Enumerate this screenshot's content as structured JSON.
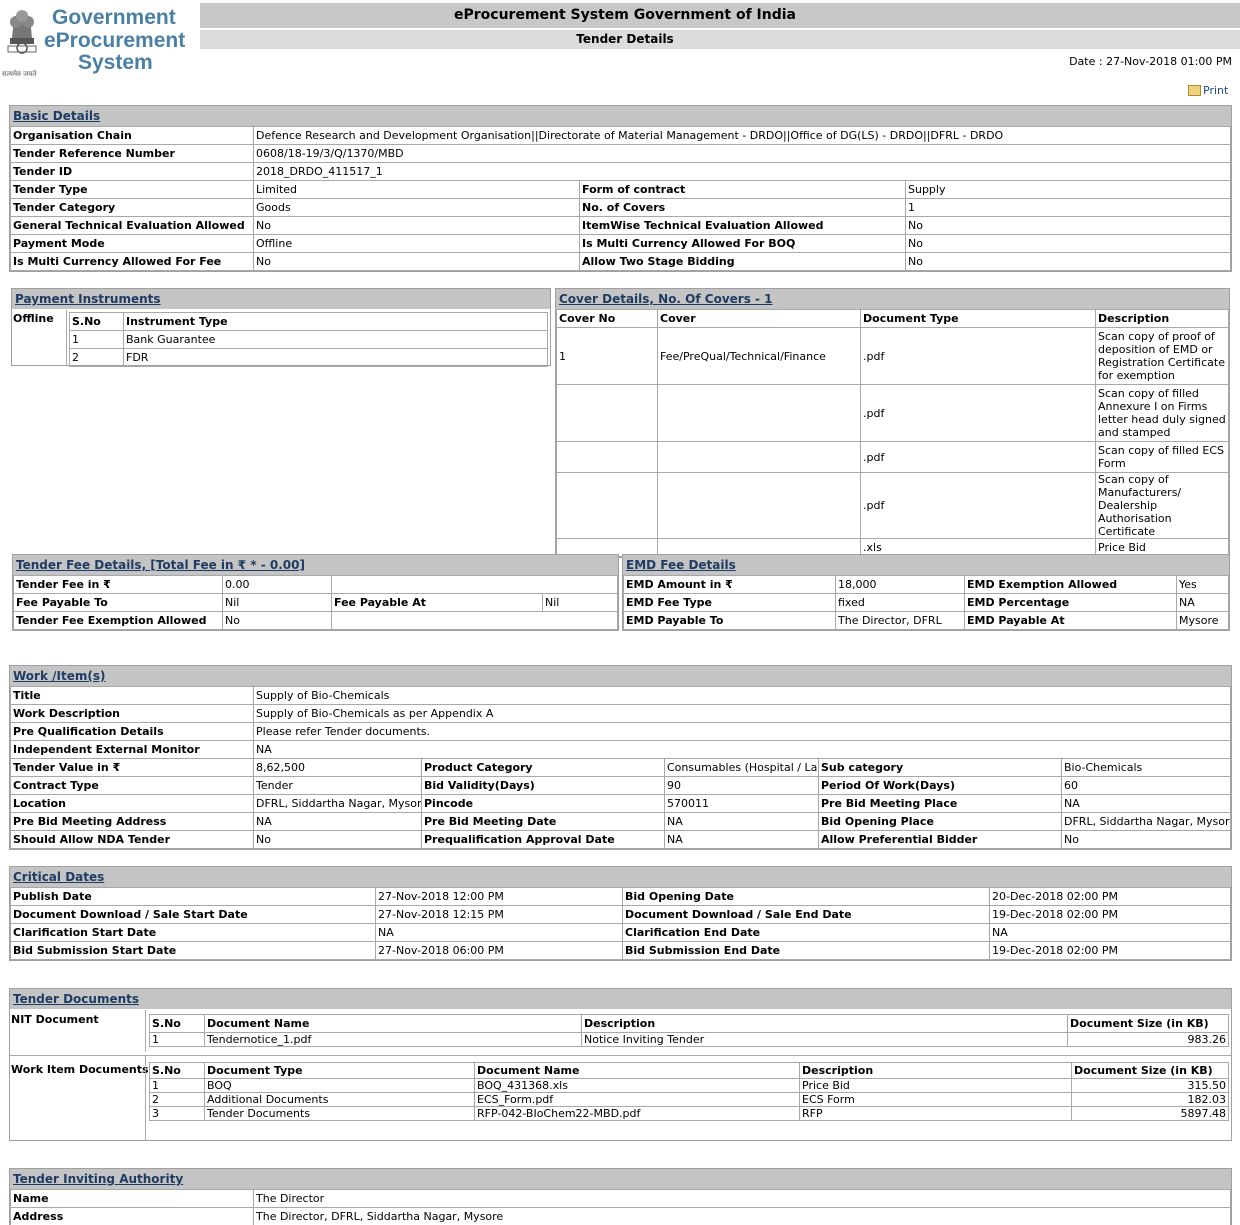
{
  "header": {
    "title": "eProcurement System Government of India",
    "subtitle": "Tender Details",
    "date": "Date : 27-Nov-2018 01:00 PM",
    "print_label": "Print",
    "logo": {
      "line1": "Government",
      "line2": "eProcurement",
      "line3": "System",
      "emblem_text": "सत्यमेव जयते"
    }
  },
  "basic": {
    "title": "Basic Details",
    "org_label": "Organisation Chain",
    "org_value": "Defence Research and Development Organisation||Directorate of Material Management - DRDO||Office of DG(LS) - DRDO||DFRL - DRDO",
    "ref_label": "Tender Reference Number",
    "ref_value": "0608/18-19/3/Q/1370/MBD",
    "id_label": "Tender ID",
    "id_value": "2018_DRDO_411517_1",
    "rows": [
      {
        "l1": "Tender Type",
        "v1": "Limited",
        "l2": "Form of contract",
        "v2": "Supply"
      },
      {
        "l1": "Tender Category",
        "v1": "Goods",
        "l2": "No. of Covers",
        "v2": "1"
      },
      {
        "l1": "General Technical Evaluation Allowed",
        "v1": "No",
        "l2": "ItemWise Technical Evaluation Allowed",
        "v2": "No"
      },
      {
        "l1": "Payment Mode",
        "v1": "Offline",
        "l2": "Is Multi Currency Allowed For BOQ",
        "v2": "No"
      },
      {
        "l1": "Is Multi Currency Allowed For Fee",
        "v1": "No",
        "l2": "Allow Two Stage Bidding",
        "v2": "No"
      }
    ]
  },
  "payment": {
    "title": "Payment Instruments",
    "mode": "Offline",
    "col1": "S.No",
    "col2": "Instrument Type",
    "rows": [
      {
        "sno": "1",
        "type": "Bank Guarantee"
      },
      {
        "sno": "2",
        "type": "FDR"
      }
    ]
  },
  "cover": {
    "title": "Cover Details, No. Of Covers - 1",
    "cols": [
      "Cover No",
      "Cover",
      "Document Type",
      "Description"
    ],
    "rows": [
      {
        "no": "1",
        "cover": "Fee/PreQual/Technical/Finance",
        "doc": ".pdf",
        "desc": "Scan copy of proof of deposition of EMD or Registration Certificate for exemption"
      },
      {
        "no": "",
        "cover": "",
        "doc": ".pdf",
        "desc": "Scan copy of filled Annexure I on Firms letter head duly signed and stamped"
      },
      {
        "no": "",
        "cover": "",
        "doc": ".pdf",
        "desc": "Scan copy of filled ECS Form"
      },
      {
        "no": "",
        "cover": "",
        "doc": ".pdf",
        "desc": "Scan copy of Manufacturers/ Dealership Authorisation Certificate"
      },
      {
        "no": "",
        "cover": "",
        "doc": ".xls",
        "desc": "Price Bid"
      }
    ]
  },
  "tenderfee": {
    "title": "Tender Fee Details, [Total Fee in ₹ * - 0.00]",
    "fee_label": "Tender Fee in ₹",
    "fee_value": "0.00",
    "payto_label": "Fee Payable To",
    "payto_value": "Nil",
    "payat_label": "Fee Payable At",
    "payat_value": "Nil",
    "exempt_label": "Tender Fee Exemption Allowed",
    "exempt_value": "No"
  },
  "emd": {
    "title": "EMD Fee Details",
    "rows": [
      {
        "l1": "EMD Amount in ₹",
        "v1": "18,000",
        "l2": "EMD Exemption Allowed",
        "v2": "Yes"
      },
      {
        "l1": "EMD Fee Type",
        "v1": "fixed",
        "l2": "EMD Percentage",
        "v2": "NA"
      },
      {
        "l1": "EMD Payable To",
        "v1": "The Director, DFRL",
        "l2": "EMD Payable At",
        "v2": "Mysore"
      }
    ]
  },
  "work": {
    "title": "Work /Item(s)",
    "simple": [
      {
        "l": "Title",
        "v": "Supply of Bio-Chemicals"
      },
      {
        "l": "Work Description",
        "v": "Supply of Bio-Chemicals as per Appendix A"
      },
      {
        "l": "Pre Qualification Details",
        "v": "Please refer Tender documents."
      },
      {
        "l": "Independent External Monitor",
        "v": "NA"
      }
    ],
    "grid": [
      {
        "l1": "Tender Value in ₹",
        "v1": "8,62,500",
        "l2": "Product Category",
        "v2": "Consumables (Hospital / Lab)",
        "l3": "Sub category",
        "v3": "Bio-Chemicals"
      },
      {
        "l1": "Contract Type",
        "v1": "Tender",
        "l2": "Bid Validity(Days)",
        "v2": "90",
        "l3": "Period Of Work(Days)",
        "v3": "60"
      },
      {
        "l1": "Location",
        "v1": "DFRL, Siddartha Nagar, Mysore",
        "l2": "Pincode",
        "v2": "570011",
        "l3": "Pre Bid Meeting Place",
        "v3": "NA"
      },
      {
        "l1": "Pre Bid Meeting Address",
        "v1": "NA",
        "l2": "Pre Bid Meeting Date",
        "v2": "NA",
        "l3": "Bid Opening Place",
        "v3": "DFRL, Siddartha Nagar, Mysore"
      },
      {
        "l1": "Should Allow NDA Tender",
        "v1": "No",
        "l2": "Prequalification Approval Date",
        "v2": "NA",
        "l3": "Allow Preferential Bidder",
        "v3": "No"
      }
    ]
  },
  "dates": {
    "title": "Critical Dates",
    "rows": [
      {
        "l1": "Publish Date",
        "v1": "27-Nov-2018 12:00 PM",
        "l2": "Bid Opening Date",
        "v2": "20-Dec-2018 02:00 PM"
      },
      {
        "l1": "Document Download / Sale Start Date",
        "v1": "27-Nov-2018 12:15 PM",
        "l2": "Document Download / Sale End Date",
        "v2": "19-Dec-2018 02:00 PM"
      },
      {
        "l1": "Clarification Start Date",
        "v1": "NA",
        "l2": "Clarification End Date",
        "v2": "NA"
      },
      {
        "l1": "Bid Submission Start Date",
        "v1": "27-Nov-2018 06:00 PM",
        "l2": "Bid Submission End Date",
        "v2": "19-Dec-2018 02:00 PM"
      }
    ]
  },
  "docs": {
    "title": "Tender Documents",
    "nit_label": "NIT Document",
    "nit_cols": [
      "S.No",
      "Document Name",
      "Description",
      "Document Size (in KB)"
    ],
    "nit_rows": [
      {
        "sno": "1",
        "name": "Tendernotice_1.pdf",
        "desc": "Notice Inviting Tender",
        "size": "983.26"
      }
    ],
    "work_label": "Work Item Documents",
    "work_cols": [
      "S.No",
      "Document Type",
      "Document Name",
      "Description",
      "Document Size (in KB)"
    ],
    "work_rows": [
      {
        "sno": "1",
        "type": "BOQ",
        "name": "BOQ_431368.xls",
        "desc": "Price Bid",
        "size": "315.50"
      },
      {
        "sno": "2",
        "type": "Additional Documents",
        "name": "ECS_Form.pdf",
        "desc": "ECS Form",
        "size": "182.03"
      },
      {
        "sno": "3",
        "type": "Tender Documents",
        "name": "RFP-042-BIoChem22-MBD.pdf",
        "desc": "RFP",
        "size": "5897.48"
      }
    ]
  },
  "authority": {
    "title": "Tender Inviting Authority",
    "name_label": "Name",
    "name_value": "The Director",
    "addr_label": "Address",
    "addr_value": "The Director, DFRL, Siddartha Nagar, Mysore"
  }
}
